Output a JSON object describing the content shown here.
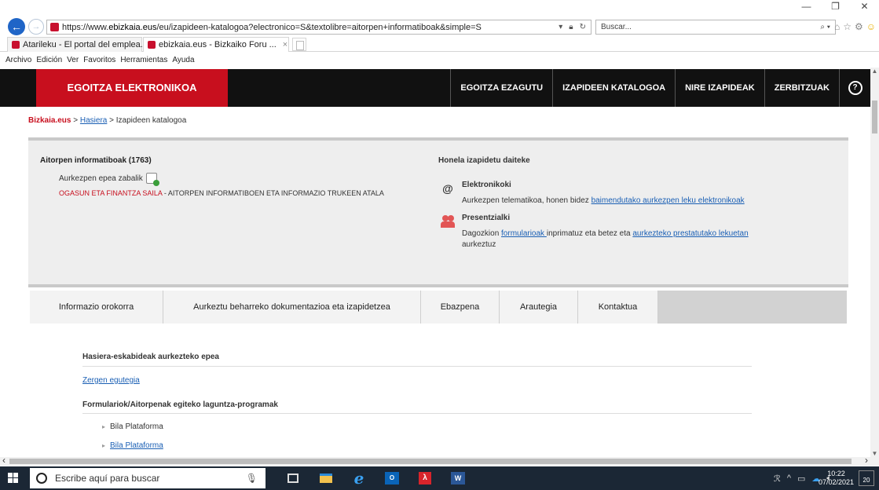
{
  "browser": {
    "url_prefix": "https://www.",
    "url_domain": "ebizkaia.eus",
    "url_rest": "/eu/izapideen-katalogoa?electronico=S&textolibre=aitorpen+informatiboak&simple=S",
    "search_placeholder": "Buscar...",
    "tabs": [
      {
        "label": "Atarileku - El portal del emplea..."
      },
      {
        "label": "ebizkaia.eus - Bizkaiko Foru ..."
      }
    ],
    "menu": [
      "Archivo",
      "Edición",
      "Ver",
      "Favoritos",
      "Herramientas",
      "Ayuda"
    ]
  },
  "site": {
    "brand": "EGOITZA ELEKTRONIKOA",
    "nav": [
      "EGOITZA EZAGUTU",
      "IZAPIDEEN KATALOGOA",
      "NIRE IZAPIDEAK",
      "ZERBITZUAK"
    ],
    "help": "?"
  },
  "breadcrumb": {
    "home": "Bizkaia.eus",
    "sep1": " > ",
    "link": "Hasiera",
    "sep2": " > ",
    "current": "Izapideen katalogoa"
  },
  "procedure": {
    "title": "Aitorpen informatiboak (1763)",
    "deadline": "Aurkezpen epea zabalik",
    "dept_red": "OGASUN ETA FINANTZA SAILA",
    "dept_rest": " - AITORPEN INFORMATIBOEN ETA INFORMAZIO TRUKEEN ATALA",
    "how_title": "Honela izapidetu daiteke",
    "electronic_label": "Elektronikoki",
    "electronic_text": "Aurkezpen telematikoa, honen bidez ",
    "electronic_link": "baimendutako aurkezpen leku elektronikoak",
    "inperson_label": "Presentzialki",
    "inperson_text1": "Dagozkion ",
    "inperson_link1": "formularioak ",
    "inperson_text2": "inprimatuz eta betez eta ",
    "inperson_link2": "aurkezteko prestatutako lekuetan",
    "inperson_text3": "aurkeztuz"
  },
  "tabs": [
    {
      "label": "Informazio orokorra"
    },
    {
      "label": "Aurkeztu beharreko dokumentazioa eta izapidetzea"
    },
    {
      "label": "Ebazpena"
    },
    {
      "label": "Arautegia"
    },
    {
      "label": "Kontaktua"
    }
  ],
  "content": {
    "section1": "Hasiera-eskabideak aurkezteko epea",
    "zergen": "Zergen egutegia",
    "section2": "Formulariok/Aitorpenak egiteko laguntza-programak",
    "items": [
      "Bila Plataforma",
      "Bila Plataforma"
    ]
  },
  "taskbar": {
    "search_placeholder": "Escribe aquí para buscar",
    "time": "10:22",
    "date": "07/02/2021",
    "notifications": "20"
  },
  "colors": {
    "brand_red": "#c80f1e",
    "header_black": "#111111",
    "link_blue": "#1a5fb4"
  }
}
